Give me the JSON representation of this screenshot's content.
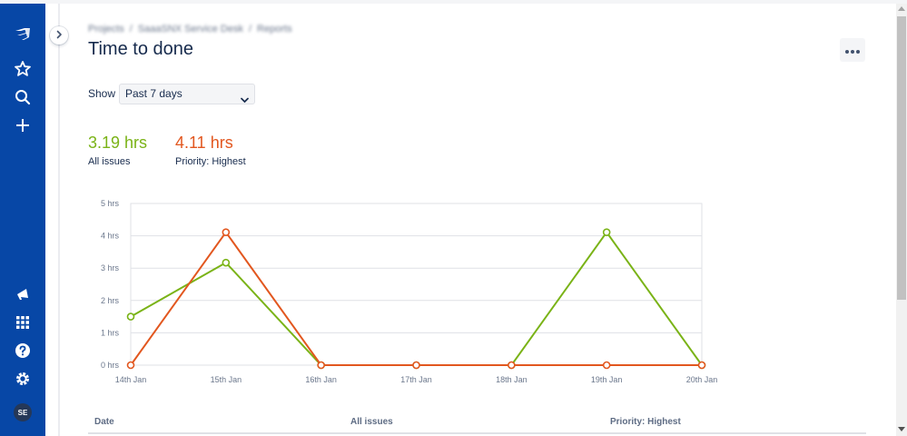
{
  "breadcrumb": [
    "Projects",
    "/",
    "SaaaSNX Service Desk",
    "/",
    "Reports"
  ],
  "page": {
    "title": "Time to done"
  },
  "filter": {
    "label": "Show",
    "selected": "Past 7 days"
  },
  "stats": [
    {
      "value": "3.19 hrs",
      "label": "All issues",
      "color": "#7ab317"
    },
    {
      "value": "4.11 hrs",
      "label": "Priority: Highest",
      "color": "#e2571f"
    }
  ],
  "sidebar": {
    "avatar_initials": "SE"
  },
  "icons": [
    "jira-logo-icon",
    "star-icon",
    "search-icon",
    "plus-icon",
    "megaphone-icon",
    "app-switcher-icon",
    "help-icon",
    "settings-icon",
    "chevron-right-icon",
    "more-icon",
    "chevron-down-icon"
  ],
  "chart_data": {
    "type": "line",
    "categories": [
      "14th Jan",
      "15th Jan",
      "16th Jan",
      "17th Jan",
      "18th Jan",
      "19th Jan",
      "20th Jan"
    ],
    "y_tick_labels": [
      "0 hrs",
      "1 hrs",
      "2 hrs",
      "3 hrs",
      "4 hrs",
      "5 hrs"
    ],
    "ylim": [
      0,
      5
    ],
    "grid": true,
    "series": [
      {
        "name": "All issues",
        "color": "#7ab317",
        "values": [
          1.5,
          3.17,
          0,
          0,
          0,
          4.11,
          0
        ]
      },
      {
        "name": "Priority: Highest",
        "color": "#e2571f",
        "values": [
          0,
          4.11,
          0,
          0,
          0,
          0,
          0
        ]
      }
    ]
  },
  "table": {
    "headers": [
      "Date",
      "All issues",
      "Priority: Highest"
    ]
  }
}
